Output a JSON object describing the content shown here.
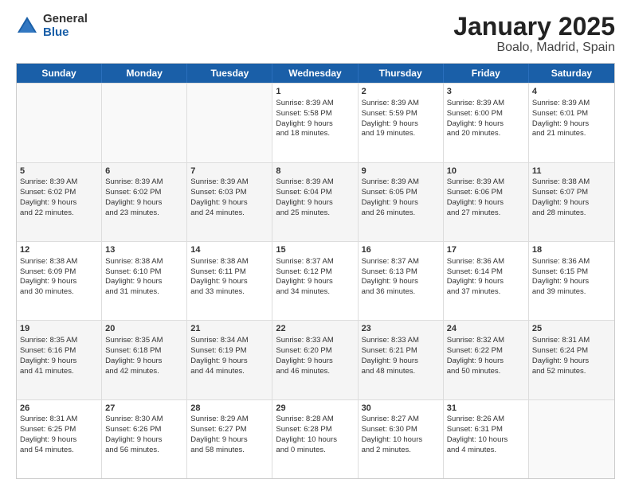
{
  "logo": {
    "general": "General",
    "blue": "Blue"
  },
  "title": "January 2025",
  "subtitle": "Boalo, Madrid, Spain",
  "days": [
    "Sunday",
    "Monday",
    "Tuesday",
    "Wednesday",
    "Thursday",
    "Friday",
    "Saturday"
  ],
  "weeks": [
    [
      {
        "day": "",
        "content": ""
      },
      {
        "day": "",
        "content": ""
      },
      {
        "day": "",
        "content": ""
      },
      {
        "day": "1",
        "content": "Sunrise: 8:39 AM\nSunset: 5:58 PM\nDaylight: 9 hours\nand 18 minutes."
      },
      {
        "day": "2",
        "content": "Sunrise: 8:39 AM\nSunset: 5:59 PM\nDaylight: 9 hours\nand 19 minutes."
      },
      {
        "day": "3",
        "content": "Sunrise: 8:39 AM\nSunset: 6:00 PM\nDaylight: 9 hours\nand 20 minutes."
      },
      {
        "day": "4",
        "content": "Sunrise: 8:39 AM\nSunset: 6:01 PM\nDaylight: 9 hours\nand 21 minutes."
      }
    ],
    [
      {
        "day": "5",
        "content": "Sunrise: 8:39 AM\nSunset: 6:02 PM\nDaylight: 9 hours\nand 22 minutes."
      },
      {
        "day": "6",
        "content": "Sunrise: 8:39 AM\nSunset: 6:02 PM\nDaylight: 9 hours\nand 23 minutes."
      },
      {
        "day": "7",
        "content": "Sunrise: 8:39 AM\nSunset: 6:03 PM\nDaylight: 9 hours\nand 24 minutes."
      },
      {
        "day": "8",
        "content": "Sunrise: 8:39 AM\nSunset: 6:04 PM\nDaylight: 9 hours\nand 25 minutes."
      },
      {
        "day": "9",
        "content": "Sunrise: 8:39 AM\nSunset: 6:05 PM\nDaylight: 9 hours\nand 26 minutes."
      },
      {
        "day": "10",
        "content": "Sunrise: 8:39 AM\nSunset: 6:06 PM\nDaylight: 9 hours\nand 27 minutes."
      },
      {
        "day": "11",
        "content": "Sunrise: 8:38 AM\nSunset: 6:07 PM\nDaylight: 9 hours\nand 28 minutes."
      }
    ],
    [
      {
        "day": "12",
        "content": "Sunrise: 8:38 AM\nSunset: 6:09 PM\nDaylight: 9 hours\nand 30 minutes."
      },
      {
        "day": "13",
        "content": "Sunrise: 8:38 AM\nSunset: 6:10 PM\nDaylight: 9 hours\nand 31 minutes."
      },
      {
        "day": "14",
        "content": "Sunrise: 8:38 AM\nSunset: 6:11 PM\nDaylight: 9 hours\nand 33 minutes."
      },
      {
        "day": "15",
        "content": "Sunrise: 8:37 AM\nSunset: 6:12 PM\nDaylight: 9 hours\nand 34 minutes."
      },
      {
        "day": "16",
        "content": "Sunrise: 8:37 AM\nSunset: 6:13 PM\nDaylight: 9 hours\nand 36 minutes."
      },
      {
        "day": "17",
        "content": "Sunrise: 8:36 AM\nSunset: 6:14 PM\nDaylight: 9 hours\nand 37 minutes."
      },
      {
        "day": "18",
        "content": "Sunrise: 8:36 AM\nSunset: 6:15 PM\nDaylight: 9 hours\nand 39 minutes."
      }
    ],
    [
      {
        "day": "19",
        "content": "Sunrise: 8:35 AM\nSunset: 6:16 PM\nDaylight: 9 hours\nand 41 minutes."
      },
      {
        "day": "20",
        "content": "Sunrise: 8:35 AM\nSunset: 6:18 PM\nDaylight: 9 hours\nand 42 minutes."
      },
      {
        "day": "21",
        "content": "Sunrise: 8:34 AM\nSunset: 6:19 PM\nDaylight: 9 hours\nand 44 minutes."
      },
      {
        "day": "22",
        "content": "Sunrise: 8:33 AM\nSunset: 6:20 PM\nDaylight: 9 hours\nand 46 minutes."
      },
      {
        "day": "23",
        "content": "Sunrise: 8:33 AM\nSunset: 6:21 PM\nDaylight: 9 hours\nand 48 minutes."
      },
      {
        "day": "24",
        "content": "Sunrise: 8:32 AM\nSunset: 6:22 PM\nDaylight: 9 hours\nand 50 minutes."
      },
      {
        "day": "25",
        "content": "Sunrise: 8:31 AM\nSunset: 6:24 PM\nDaylight: 9 hours\nand 52 minutes."
      }
    ],
    [
      {
        "day": "26",
        "content": "Sunrise: 8:31 AM\nSunset: 6:25 PM\nDaylight: 9 hours\nand 54 minutes."
      },
      {
        "day": "27",
        "content": "Sunrise: 8:30 AM\nSunset: 6:26 PM\nDaylight: 9 hours\nand 56 minutes."
      },
      {
        "day": "28",
        "content": "Sunrise: 8:29 AM\nSunset: 6:27 PM\nDaylight: 9 hours\nand 58 minutes."
      },
      {
        "day": "29",
        "content": "Sunrise: 8:28 AM\nSunset: 6:28 PM\nDaylight: 10 hours\nand 0 minutes."
      },
      {
        "day": "30",
        "content": "Sunrise: 8:27 AM\nSunset: 6:30 PM\nDaylight: 10 hours\nand 2 minutes."
      },
      {
        "day": "31",
        "content": "Sunrise: 8:26 AM\nSunset: 6:31 PM\nDaylight: 10 hours\nand 4 minutes."
      },
      {
        "day": "",
        "content": ""
      }
    ]
  ]
}
